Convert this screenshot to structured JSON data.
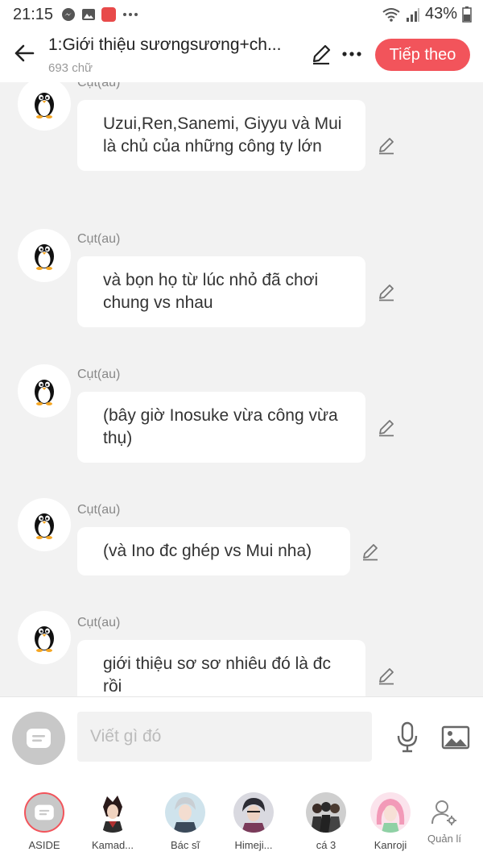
{
  "status_bar": {
    "time": "21:15",
    "battery": "43%"
  },
  "header": {
    "title": "1:Giới thiệu sươngsương+ch...",
    "word_count": "693 chữ",
    "next_label": "Tiếp theo"
  },
  "messages": [
    {
      "name": "Cụt(au)",
      "text": "Uzui,Ren,Sanemi, Giyyu và Mui là chủ của những công ty lớn"
    },
    {
      "name": "Cụt(au)",
      "text": "và bọn họ từ lúc nhỏ đã chơi chung vs nhau"
    },
    {
      "name": "Cụt(au)",
      "text": "(bây giờ Inosuke vừa công vừa thụ)"
    },
    {
      "name": "Cụt(au)",
      "text": "(và Ino đc ghép vs Mui nha)"
    },
    {
      "name": "Cụt(au)",
      "text": "giới thiệu sơ sơ nhiêu đó là đc rồi"
    }
  ],
  "composer": {
    "placeholder": "Viết gì đó"
  },
  "characters": [
    {
      "label": "ASIDE"
    },
    {
      "label": "Kamad..."
    },
    {
      "label": "Bác sĩ"
    },
    {
      "label": "Himeji..."
    },
    {
      "label": "cá 3"
    },
    {
      "label": "Kanroji"
    },
    {
      "label": "Quản lí"
    }
  ],
  "colors": {
    "accent": "#f2545b",
    "background": "#f2f2f2",
    "bubble": "#ffffff"
  }
}
